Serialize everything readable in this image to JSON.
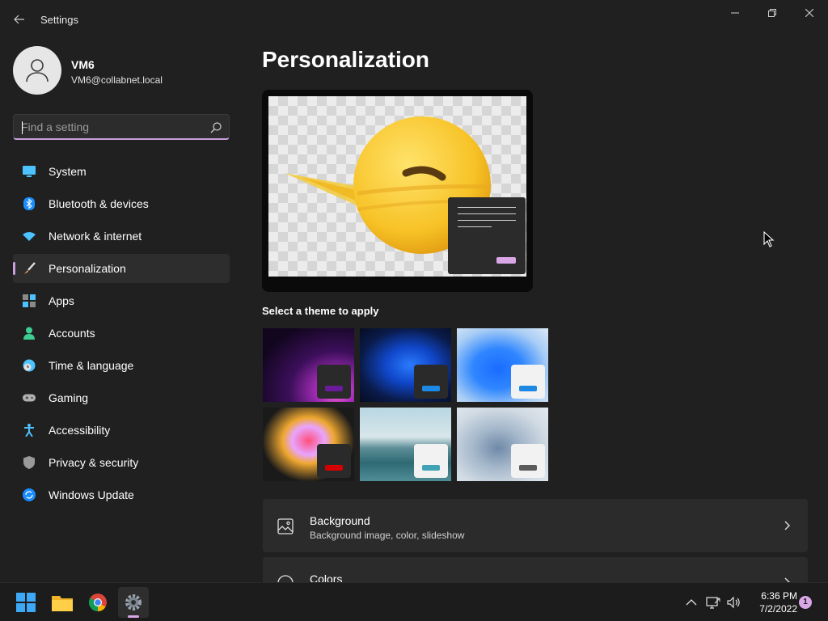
{
  "window": {
    "title": "Settings"
  },
  "profile": {
    "name": "VM6",
    "email": "VM6@collabnet.local"
  },
  "search": {
    "placeholder": "Find a setting",
    "value": ""
  },
  "sidebar": {
    "items": [
      {
        "label": "System",
        "icon": "monitor-icon"
      },
      {
        "label": "Bluetooth & devices",
        "icon": "bluetooth-icon"
      },
      {
        "label": "Network & internet",
        "icon": "wifi-icon"
      },
      {
        "label": "Personalization",
        "icon": "brush-icon",
        "active": true
      },
      {
        "label": "Apps",
        "icon": "apps-icon"
      },
      {
        "label": "Accounts",
        "icon": "person-icon"
      },
      {
        "label": "Time & language",
        "icon": "clock-globe-icon"
      },
      {
        "label": "Gaming",
        "icon": "controller-icon"
      },
      {
        "label": "Accessibility",
        "icon": "accessibility-icon"
      },
      {
        "label": "Privacy & security",
        "icon": "shield-icon"
      },
      {
        "label": "Windows Update",
        "icon": "update-icon"
      }
    ]
  },
  "main": {
    "title": "Personalization",
    "themes_label": "Select a theme to apply",
    "themes": [
      {
        "name": "theme-glow",
        "mini_bg": "#2a2a2a",
        "bar": "#6a1b9a"
      },
      {
        "name": "theme-dark-bloom",
        "mini_bg": "#2a2a2a",
        "bar": "#1e88e5"
      },
      {
        "name": "theme-light-bloom",
        "mini_bg": "#f2f2f2",
        "bar": "#1e88e5"
      },
      {
        "name": "theme-captured-motion",
        "mini_bg": "#2a2a2a",
        "bar": "#d50000"
      },
      {
        "name": "theme-flow",
        "mini_bg": "#f2f2f2",
        "bar": "#3fa3b5"
      },
      {
        "name": "theme-sunrise",
        "mini_bg": "#f2f2f2",
        "bar": "#5a5a5a"
      }
    ],
    "cards": [
      {
        "title": "Background",
        "subtitle": "Background image, color, slideshow",
        "icon": "image-icon"
      },
      {
        "title": "Colors",
        "subtitle": "",
        "icon": "palette-icon"
      }
    ]
  },
  "taskbar": {
    "apps": [
      {
        "name": "start-button",
        "icon": "windows-logo-icon"
      },
      {
        "name": "file-explorer",
        "icon": "folder-icon"
      },
      {
        "name": "chrome",
        "icon": "chrome-icon"
      },
      {
        "name": "settings",
        "icon": "gear-icon",
        "active": true
      }
    ],
    "time": "6:36 PM",
    "date": "7/2/2022",
    "notification_count": "1"
  },
  "colors": {
    "accent": "#c9a0dc",
    "background": "#202020",
    "card": "#2b2b2b"
  }
}
